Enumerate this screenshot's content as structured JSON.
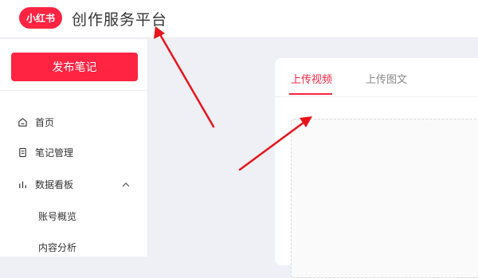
{
  "header": {
    "logo_text": "小红书",
    "title": "创作服务平台"
  },
  "sidebar": {
    "publish_label": "发布笔记",
    "items": [
      {
        "label": "首页",
        "icon": "home-icon"
      },
      {
        "label": "笔记管理",
        "icon": "note-icon"
      },
      {
        "label": "数据看板",
        "icon": "bar-chart-icon",
        "expanded": true
      }
    ],
    "subitems": [
      {
        "label": "账号概览"
      },
      {
        "label": "内容分析"
      }
    ]
  },
  "main": {
    "tabs": [
      {
        "label": "上传视频",
        "active": true
      },
      {
        "label": "上传图文",
        "active": false
      }
    ]
  },
  "colors": {
    "brand": "#ff2442",
    "annotation_arrow": "#e8141b"
  }
}
